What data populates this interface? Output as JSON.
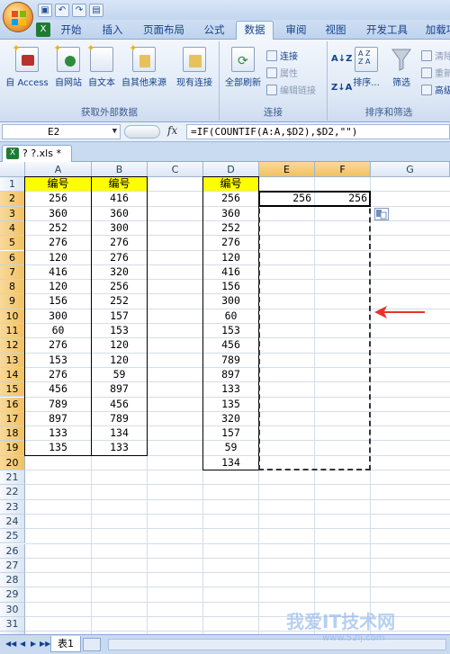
{
  "qat": {
    "save_icon": "save-icon",
    "undo_icon": "undo-icon",
    "redo_icon": "redo-icon",
    "preview_icon": "print-preview-icon"
  },
  "tabs": [
    {
      "label": "开始"
    },
    {
      "label": "插入"
    },
    {
      "label": "页面布局"
    },
    {
      "label": "公式"
    },
    {
      "label": "数据",
      "active": true
    },
    {
      "label": "审阅"
    },
    {
      "label": "视图"
    },
    {
      "label": "开发工具"
    },
    {
      "label": "加载项"
    }
  ],
  "ribbon": {
    "external": {
      "label": "获取外部数据",
      "access": "自 Access",
      "web": "自网站",
      "text": "自文本",
      "other": "自其他来源",
      "existing": "现有连接"
    },
    "connections": {
      "label": "连接",
      "refresh": "全部刷新",
      "connections": "连接",
      "properties": "属性",
      "edit_links": "编辑链接"
    },
    "sort_filter": {
      "label": "排序和筛选",
      "sort": "排序...",
      "filter": "筛选",
      "clear": "清除",
      "reapply": "重新",
      "advanced": "高级"
    }
  },
  "formula_bar": {
    "name_box": "E2",
    "fx": "fx",
    "formula": "=IF(COUNTIF(A:A,$D2),$D2,\"\")"
  },
  "workbook_tab": "? ?.xls *",
  "columns": [
    "A",
    "B",
    "C",
    "D",
    "E",
    "F",
    "G"
  ],
  "rows": [
    "1",
    "2",
    "3",
    "4",
    "5",
    "6",
    "7",
    "8",
    "9",
    "10",
    "11",
    "12",
    "13",
    "14",
    "15",
    "16",
    "17",
    "18",
    "19",
    "20",
    "21",
    "22",
    "23",
    "24",
    "25",
    "26",
    "27",
    "28",
    "29",
    "30",
    "31",
    "32"
  ],
  "sheet": {
    "header_label": "编号",
    "colA": [
      "256",
      "360",
      "252",
      "276",
      "120",
      "416",
      "120",
      "156",
      "300",
      "60",
      "276",
      "153",
      "276",
      "456",
      "789",
      "897",
      "133",
      "135"
    ],
    "colB": [
      "416",
      "360",
      "300",
      "276",
      "276",
      "320",
      "256",
      "252",
      "157",
      "153",
      "120",
      "120",
      "59",
      "897",
      "456",
      "789",
      "134",
      "133"
    ],
    "colD": [
      "256",
      "360",
      "252",
      "276",
      "120",
      "416",
      "156",
      "300",
      "60",
      "153",
      "456",
      "789",
      "897",
      "133",
      "135",
      "320",
      "157",
      "59",
      "134"
    ],
    "E2": "256",
    "F2": "256"
  },
  "sheet_tabs": {
    "sheet1": "表1"
  },
  "colors": {
    "header_fill": "#ffff00",
    "arrow": "#e8322b",
    "selection": "#f1c15f"
  },
  "watermark": {
    "main": "我爱IT技术网",
    "sub": "www.52ij.com"
  }
}
